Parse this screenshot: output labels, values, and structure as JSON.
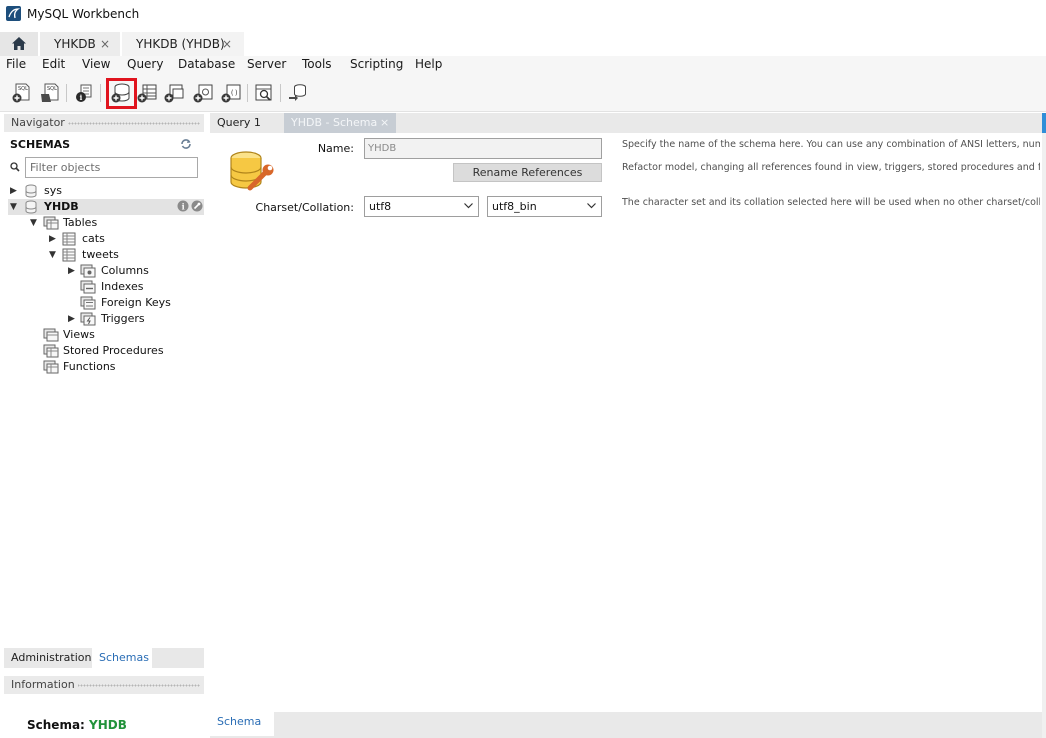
{
  "window": {
    "title": "MySQL Workbench"
  },
  "connection_tabs": [
    {
      "label": "YHKDB",
      "close": "×"
    },
    {
      "label": "YHKDB (YHDB)",
      "close": "×"
    }
  ],
  "menu": [
    "File",
    "Edit",
    "View",
    "Query",
    "Database",
    "Server",
    "Tools",
    "Scripting",
    "Help"
  ],
  "toolbar": {
    "buttons": [
      "new-sql-tab-icon",
      "open-sql-script-icon",
      "inspector-icon",
      "create-schema-icon",
      "create-table-icon",
      "create-view-icon",
      "create-procedure-icon",
      "create-function-icon",
      "search-table-data-icon",
      "reconnect-icon"
    ],
    "highlighted": "create-schema-icon",
    "highlight_color": "#e0141e"
  },
  "navigator": {
    "header": "Navigator",
    "schemas_title": "SCHEMAS",
    "filter_placeholder": "Filter objects",
    "tree": {
      "sys": "sys",
      "yhdb": "YHDB",
      "tables": "Tables",
      "cats": "cats",
      "tweets": "tweets",
      "columns": "Columns",
      "indexes": "Indexes",
      "foreign_keys": "Foreign Keys",
      "triggers": "Triggers",
      "views": "Views",
      "stored_procedures": "Stored Procedures",
      "functions": "Functions"
    },
    "bottom_tabs": {
      "administration": "Administration",
      "schemas": "Schemas"
    },
    "info_header": "Information",
    "info": {
      "label": "Schema:",
      "value": "YHDB",
      "value_color": "#21923a"
    }
  },
  "editor": {
    "tabs": {
      "query": "Query 1",
      "schema": "YHDB - Schema",
      "close": "×"
    },
    "form": {
      "name_label": "Name:",
      "name_value": "YHDB",
      "rename_button": "Rename References",
      "charset_label": "Charset/Collation:",
      "charset_value": "utf8",
      "collation_value": "utf8_bin"
    },
    "help": {
      "name": "Specify the name of the schema here. You can use any combination of ANSI letters, numbers",
      "refactor": "Refactor model, changing all references found in view, triggers, stored procedures and functions from",
      "charset": "The character set and its collation selected here will be used when no other charset/collation i"
    },
    "bottom_tab": "Schema"
  }
}
